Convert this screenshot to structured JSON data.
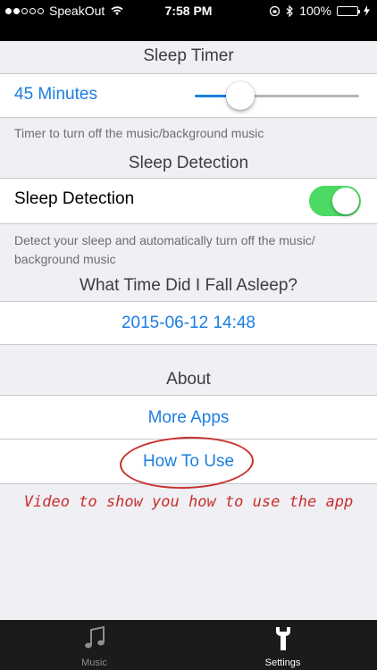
{
  "status_bar": {
    "carrier": "SpeakOut",
    "time": "7:58 PM",
    "battery": "100%",
    "signal_dots_filled": 2,
    "signal_dots_total": 5
  },
  "sleep_timer": {
    "header": "Sleep Timer",
    "value_label": "45 Minutes",
    "slider_fraction": 0.23,
    "footnote": "Timer to turn off the music/background music"
  },
  "sleep_detection": {
    "header": "Sleep Detection",
    "toggle_label": "Sleep Detection",
    "toggle_on": true,
    "footnote": "Detect your sleep and automatically turn off the music/ background music"
  },
  "fall_asleep": {
    "header": "What Time Did I Fall Asleep?",
    "datetime": "2015-06-12 14:48"
  },
  "about": {
    "header": "About",
    "more_apps": "More Apps",
    "how_to_use": "How To Use"
  },
  "annotation": {
    "text": "Video to show you how to use the app"
  },
  "tab_bar": {
    "tabs": [
      {
        "label": "Music",
        "icon": "music-note-icon",
        "active": false
      },
      {
        "label": "Settings",
        "icon": "wrench-icon",
        "active": true
      }
    ]
  },
  "colors": {
    "accent": "#1c7ee0",
    "toggle_on": "#4cd964",
    "annotation": "#c9302c"
  }
}
